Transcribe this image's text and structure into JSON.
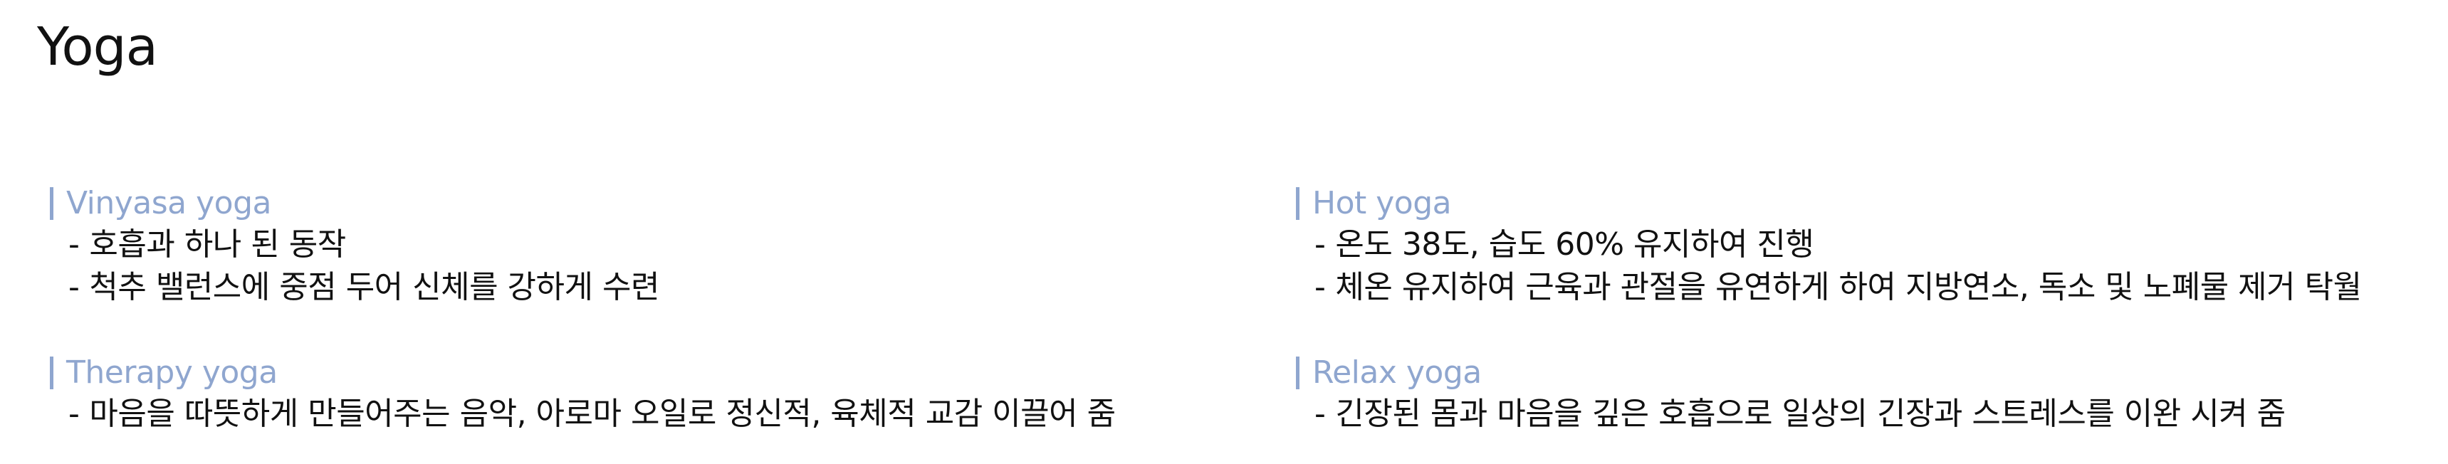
{
  "page": {
    "title": "Yoga"
  },
  "colors": {
    "heading_accent": "#8fa6cf",
    "text": "#111111",
    "background": "#ffffff"
  },
  "sections": {
    "vinyasa": {
      "heading": "Vinyasa yoga",
      "lines": [
        "호흡과 하나 된 동작",
        "척추 밸런스에 중점 두어 신체를 강하게 수련"
      ]
    },
    "hot": {
      "heading": "Hot yoga",
      "lines": [
        "온도 38도, 습도 60% 유지하여 진행",
        "체온 유지하여 근육과 관절을 유연하게 하여 지방연소, 독소 및 노폐물 제거 탁월"
      ]
    },
    "therapy": {
      "heading": "Therapy yoga",
      "lines": [
        "마음을 따뜻하게 만들어주는 음악, 아로마 오일로 정신적, 육체적 교감 이끌어 줌"
      ]
    },
    "relax": {
      "heading": "Relax yoga",
      "lines": [
        "긴장된 몸과 마음을 깊은 호흡으로 일상의 긴장과 스트레스를 이완 시켜 줌"
      ]
    }
  },
  "bullet_marker": "-"
}
